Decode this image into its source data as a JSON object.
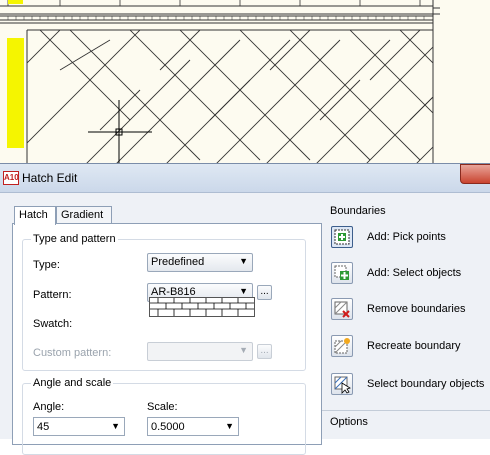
{
  "dialog": {
    "title": "Hatch Edit",
    "app_icon_text": "A10",
    "tabs": [
      {
        "label": "Hatch",
        "active": true
      },
      {
        "label": "Gradient",
        "active": false
      }
    ],
    "type_and_pattern": {
      "group_title": "Type and pattern",
      "type_label": "Type:",
      "type_value": "Predefined",
      "pattern_label": "Pattern:",
      "pattern_value": "AR-B816",
      "pattern_browse": "...",
      "swatch_label": "Swatch:",
      "custom_pattern_label": "Custom pattern:",
      "custom_pattern_value": "",
      "custom_browse": "..."
    },
    "angle_and_scale": {
      "group_title": "Angle and scale",
      "angle_label": "Angle:",
      "angle_value": "45",
      "scale_label": "Scale:",
      "scale_value": "0.5000"
    },
    "boundaries": {
      "title": "Boundaries",
      "actions": [
        {
          "label": "Add: Pick points",
          "icon": "pick-points-icon"
        },
        {
          "label": "Add: Select objects",
          "icon": "select-objects-icon"
        },
        {
          "label": "Remove boundaries",
          "icon": "remove-boundaries-icon"
        },
        {
          "label": "Recreate boundary",
          "icon": "recreate-boundary-icon"
        },
        {
          "label": "Select boundary objects",
          "icon": "select-boundary-objects-icon"
        }
      ]
    },
    "options": {
      "title": "Options"
    }
  },
  "colors": {
    "canvas_bg": "#fdfbf0",
    "highlight_yellow": "#f5f500",
    "dialog_bg": "#eef1f6",
    "close_red": "#c9442f"
  }
}
